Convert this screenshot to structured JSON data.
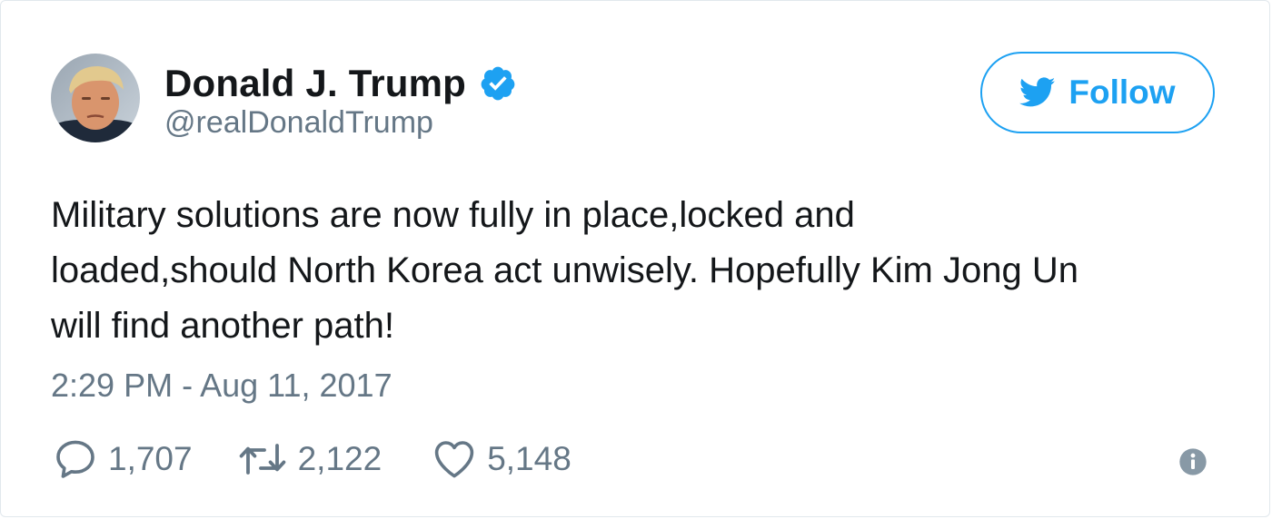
{
  "tweet": {
    "author": {
      "display_name": "Donald J. Trump",
      "handle": "@realDonaldTrump",
      "verified": true
    },
    "follow_button": {
      "label": "Follow"
    },
    "text_lines": [
      "Military solutions are now fully in place,locked and",
      "loaded,should North Korea act unwisely. Hopefully Kim Jong Un",
      "will find another path!"
    ],
    "timestamp": "2:29 PM - Aug 11, 2017",
    "stats": {
      "replies": "1,707",
      "retweets": "2,122",
      "likes": "5,148"
    }
  },
  "icons": {
    "verified": "verified-badge-icon",
    "follow": "twitter-bird-icon",
    "reply": "speech-bubble-icon",
    "retweet": "retweet-arrows-icon",
    "like": "heart-icon",
    "info": "info-icon"
  },
  "colors": {
    "brand_blue": "#1da1f2",
    "text_primary": "#14171a",
    "text_secondary": "#657786"
  }
}
